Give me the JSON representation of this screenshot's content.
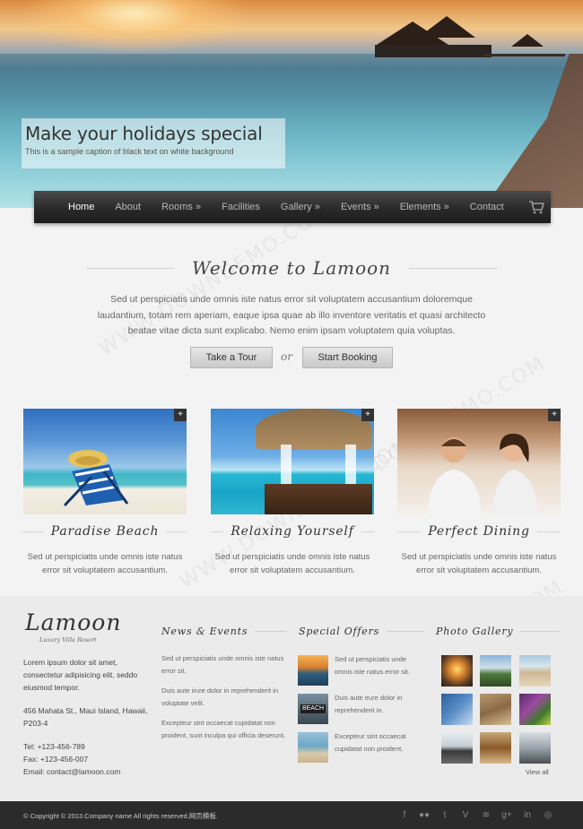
{
  "hero": {
    "caption_title": "Make your holidays special",
    "caption_text": "This is a sample caption of black text on white background"
  },
  "nav": {
    "items": [
      "Home",
      "About",
      "Rooms »",
      "Facilities",
      "Gallery »",
      "Events »",
      "Elements »",
      "Contact"
    ],
    "active": "Home",
    "cart_icon": "cart-icon"
  },
  "welcome": {
    "title": "Welcome to Lamoon",
    "text": "Sed ut perspiciatis unde omnis iste natus error sit voluptatem accusantium doloremque laudantium, totam rem aperiam, eaque ipsa quae ab illo inventore veritatis et quasi architecto beatae vitae dicta sunt explicabo. Nemo enim ipsam voluptatem quia voluptas.",
    "tour_button": "Take a Tour",
    "or": "or",
    "booking_button": "Start Booking"
  },
  "features": [
    {
      "title": "Paradise Beach",
      "text": "Sed ut perspiciatis unde omnis iste natus error sit voluptatem accusantium."
    },
    {
      "title": "Relaxing Yourself",
      "text": "Sed ut perspiciatis unde omnis iste natus error sit voluptatem accusantium."
    },
    {
      "title": "Perfect Dining",
      "text": "Sed ut perspiciatis unde omnis iste natus error sit voluptatem accusantium."
    }
  ],
  "footer": {
    "logo": "Lamoon",
    "logo_sub": "Luxury Villa Resort",
    "about": "Lorem ipsum dolor sit amet, consectetur adipisicing elit, seddo eiusmod tempor.",
    "address": "456 Mahata St., Maui Island, Hawaii, P203-4",
    "tel": "Tel: +123-456-789",
    "fax": "Fax: +123-456-007",
    "email": "Email: contact@lamoon.com",
    "news_title": "News & Events",
    "news": [
      "Sed ut perspiciatis unde omnis iste natus error sit.",
      "Duis aute irure dolor in reprehenderit in voluptate velit.",
      "Excepteur sint occaecat cupidatat non proident, sunt inculpa qui officia deserunt."
    ],
    "offers_title": "Special Offers",
    "offers": [
      "Sed ut perspiciatis unde omnis iste natus error sit.",
      "Duis aute irure dolor in reprehenderit in.",
      "Excepteur sint occaecat cupidatat non proident."
    ],
    "offer2_sign": "BEACH",
    "gallery_title": "Photo Gallery",
    "view_all": "View all"
  },
  "bottom": {
    "copyright": "© Copyright © 2013.Company name All rights reserved.网页模板.",
    "social_icons": [
      "facebook-icon",
      "flickr-icon",
      "twitter-icon",
      "vimeo-icon",
      "rss-icon",
      "googleplus-icon",
      "linkedin-icon",
      "dribbble-icon"
    ]
  },
  "watermark": "WWW.DOWNDEMO.COM",
  "colors": {
    "nav_bg": "#2a2a2a",
    "footer_bg": "#ebebeb",
    "bottom_bg": "#2b2b2b"
  }
}
